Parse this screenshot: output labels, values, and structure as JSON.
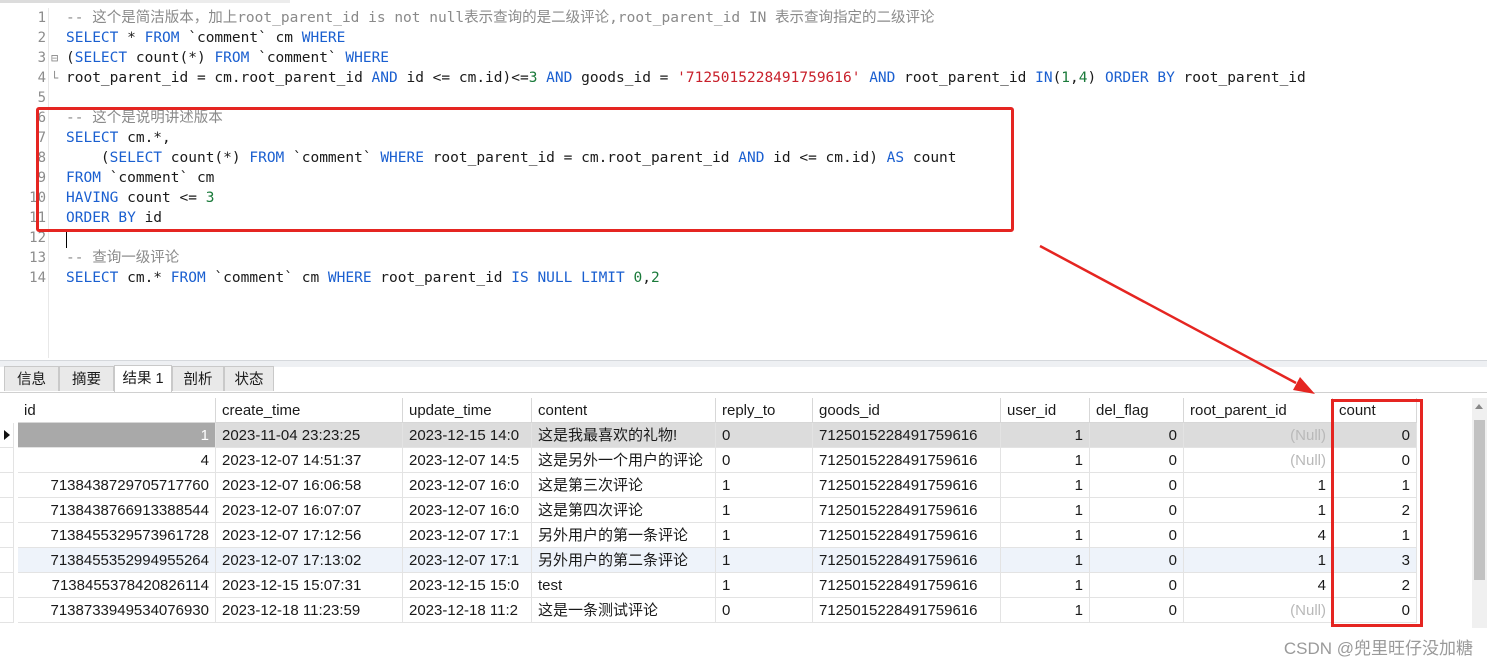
{
  "editor": {
    "lines": [
      {
        "num": "1",
        "tokens": [
          {
            "t": "-- 这个是简洁版本，加上root_parent_id is not null表示查询的是二级评论,root_parent_id IN 表示查询指定的二级评论",
            "c": "c"
          }
        ]
      },
      {
        "num": "2",
        "tokens": [
          {
            "t": "SELECT",
            "c": "k"
          },
          {
            "t": " * ",
            "c": "p"
          },
          {
            "t": "FROM",
            "c": "k"
          },
          {
            "t": " `comment` cm ",
            "c": "p"
          },
          {
            "t": "WHERE",
            "c": "k"
          }
        ]
      },
      {
        "num": "3",
        "fold": "⊟",
        "tokens": [
          {
            "t": "(",
            "c": "p"
          },
          {
            "t": "SELECT",
            "c": "k"
          },
          {
            "t": " count(*) ",
            "c": "p"
          },
          {
            "t": "FROM",
            "c": "k"
          },
          {
            "t": " `comment` ",
            "c": "p"
          },
          {
            "t": "WHERE",
            "c": "k"
          }
        ]
      },
      {
        "num": "4",
        "fold": "└",
        "tokens": [
          {
            "t": "root_parent_id = cm.root_parent_id ",
            "c": "p"
          },
          {
            "t": "AND",
            "c": "k"
          },
          {
            "t": " id <= cm.id)<=",
            "c": "p"
          },
          {
            "t": "3",
            "c": "n"
          },
          {
            "t": " ",
            "c": "p"
          },
          {
            "t": "AND",
            "c": "k"
          },
          {
            "t": " goods_id = ",
            "c": "p"
          },
          {
            "t": "'7125015228491759616'",
            "c": "s"
          },
          {
            "t": " ",
            "c": "p"
          },
          {
            "t": "AND",
            "c": "k"
          },
          {
            "t": " root_parent_id ",
            "c": "p"
          },
          {
            "t": "IN",
            "c": "k"
          },
          {
            "t": "(",
            "c": "p"
          },
          {
            "t": "1",
            "c": "n"
          },
          {
            "t": ",",
            "c": "p"
          },
          {
            "t": "4",
            "c": "n"
          },
          {
            "t": ") ",
            "c": "p"
          },
          {
            "t": "ORDER BY",
            "c": "k"
          },
          {
            "t": " root_parent_id",
            "c": "p"
          }
        ]
      },
      {
        "num": "5",
        "tokens": []
      },
      {
        "num": "6",
        "tokens": [
          {
            "t": "-- 这个是说明讲述版本",
            "c": "c"
          }
        ]
      },
      {
        "num": "7",
        "tokens": [
          {
            "t": "SELECT",
            "c": "k"
          },
          {
            "t": " cm.*,",
            "c": "p"
          }
        ]
      },
      {
        "num": "8",
        "tokens": [
          {
            "t": "    (",
            "c": "p"
          },
          {
            "t": "SELECT",
            "c": "k"
          },
          {
            "t": " count(*) ",
            "c": "p"
          },
          {
            "t": "FROM",
            "c": "k"
          },
          {
            "t": " `comment` ",
            "c": "p"
          },
          {
            "t": "WHERE",
            "c": "k"
          },
          {
            "t": " root_parent_id = cm.root_parent_id ",
            "c": "p"
          },
          {
            "t": "AND",
            "c": "k"
          },
          {
            "t": " id <= cm.id) ",
            "c": "p"
          },
          {
            "t": "AS",
            "c": "k"
          },
          {
            "t": " count",
            "c": "p"
          }
        ]
      },
      {
        "num": "9",
        "tokens": [
          {
            "t": "FROM",
            "c": "k"
          },
          {
            "t": " `comment` cm",
            "c": "p"
          }
        ]
      },
      {
        "num": "10",
        "tokens": [
          {
            "t": "HAVING",
            "c": "k"
          },
          {
            "t": " count <= ",
            "c": "p"
          },
          {
            "t": "3",
            "c": "n"
          }
        ]
      },
      {
        "num": "11",
        "tokens": [
          {
            "t": "ORDER BY",
            "c": "k"
          },
          {
            "t": " id",
            "c": "p"
          }
        ]
      },
      {
        "num": "12",
        "tokens": []
      },
      {
        "num": "13",
        "tokens": [
          {
            "t": "-- 查询一级评论",
            "c": "c"
          }
        ]
      },
      {
        "num": "14",
        "tokens": [
          {
            "t": "SELECT",
            "c": "k"
          },
          {
            "t": " cm.* ",
            "c": "p"
          },
          {
            "t": "FROM",
            "c": "k"
          },
          {
            "t": " `comment` cm ",
            "c": "p"
          },
          {
            "t": "WHERE",
            "c": "k"
          },
          {
            "t": " root_parent_id ",
            "c": "p"
          },
          {
            "t": "IS NULL LIMIT",
            "c": "k"
          },
          {
            "t": " ",
            "c": "p"
          },
          {
            "t": "0",
            "c": "n"
          },
          {
            "t": ",",
            "c": "p"
          },
          {
            "t": "2",
            "c": "n"
          }
        ]
      }
    ]
  },
  "tabs": [
    {
      "label": "信息"
    },
    {
      "label": "摘要"
    },
    {
      "label": "结果 1",
      "active": true
    },
    {
      "label": "剖析"
    },
    {
      "label": "状态"
    }
  ],
  "grid": {
    "columns": [
      "id",
      "create_time",
      "update_time",
      "content",
      "reply_to",
      "goods_id",
      "user_id",
      "del_flag",
      "root_parent_id",
      "count"
    ],
    "rows": [
      [
        "1",
        "2023-11-04 23:23:25",
        "2023-12-15 14:0",
        "这是我最喜欢的礼物!",
        "0",
        "7125015228491759616",
        "1",
        "0",
        "(Null)",
        "0"
      ],
      [
        "4",
        "2023-12-07 14:51:37",
        "2023-12-07 14:5",
        "这是另外一个用户的评论",
        "0",
        "7125015228491759616",
        "1",
        "0",
        "(Null)",
        "0"
      ],
      [
        "7138438729705717760",
        "2023-12-07 16:06:58",
        "2023-12-07 16:0",
        "这是第三次评论",
        "1",
        "7125015228491759616",
        "1",
        "0",
        "1",
        "1"
      ],
      [
        "7138438766913388544",
        "2023-12-07 16:07:07",
        "2023-12-07 16:0",
        "这是第四次评论",
        "1",
        "7125015228491759616",
        "1",
        "0",
        "1",
        "2"
      ],
      [
        "7138455329573961728",
        "2023-12-07 17:12:56",
        "2023-12-07 17:1",
        "另外用户的第一条评论",
        "1",
        "7125015228491759616",
        "1",
        "0",
        "4",
        "1"
      ],
      [
        "7138455352994955264",
        "2023-12-07 17:13:02",
        "2023-12-07 17:1",
        "另外用户的第二条评论",
        "1",
        "7125015228491759616",
        "1",
        "0",
        "1",
        "3"
      ],
      [
        "7138455378420826114",
        "2023-12-15 15:07:31",
        "2023-12-15 15:0",
        "test",
        "1",
        "7125015228491759616",
        "1",
        "0",
        "4",
        "2"
      ],
      [
        "7138733949534076930",
        "2023-12-18 11:23:59",
        "2023-12-18 11:2",
        "这是一条测试评论",
        "0",
        "7125015228491759616",
        "1",
        "0",
        "(Null)",
        "0"
      ]
    ],
    "selected_row": 0,
    "highlighted_row": 5
  },
  "watermark": "CSDN @兜里旺仔没加糖",
  "colors": {
    "annotation": "#e52521",
    "keyword": "#1a5fd0",
    "string": "#c8202b",
    "comment": "#8a8a8a"
  }
}
